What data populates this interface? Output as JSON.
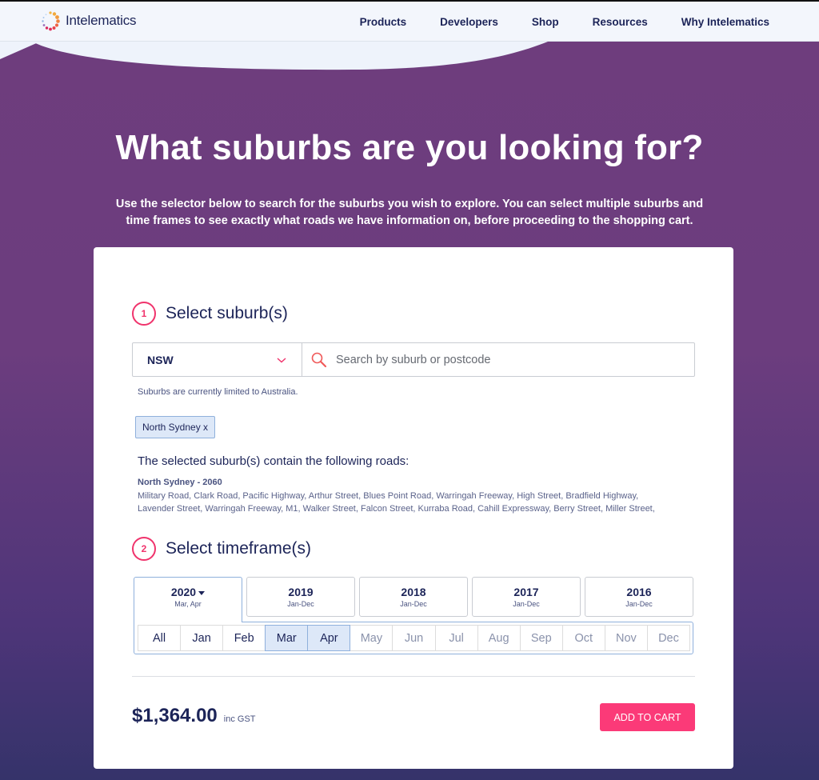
{
  "brand": {
    "name": "Intelematics"
  },
  "nav": {
    "items": [
      "Products",
      "Developers",
      "Shop",
      "Resources",
      "Why Intelematics"
    ]
  },
  "hero": {
    "title": "What suburbs are you looking for?",
    "subtitle": "Use the selector below to search for the suburbs you wish to explore. You can select multiple suburbs and time frames to see exactly what roads we have information on, before proceeding to the shopping cart."
  },
  "step1": {
    "number": "1",
    "title": "Select suburb(s)",
    "state_value": "NSW",
    "search_placeholder": "Search by suburb or postcode",
    "search_value": "",
    "hint": "Suburbs are currently limited to Australia.",
    "selected_chip": "North Sydney x",
    "roads_heading": "The selected suburb(s) contain the following roads:",
    "roads_suburb": "North Sydney - 2060",
    "roads_list": "Military Road, Clark Road, Pacific Highway, Arthur Street, Blues Point Road, Warringah Freeway, High Street, Bradfield Highway, Lavender Street, Warringah Freeway, M1, Walker Street, Falcon Street, Kurraba Road, Cahill Expressway, Berry Street, Miller Street,"
  },
  "step2": {
    "number": "2",
    "title": "Select timeframe(s)",
    "years": [
      {
        "label": "2020",
        "range": "Mar, Apr",
        "active": true
      },
      {
        "label": "2019",
        "range": "Jan-Dec",
        "active": false
      },
      {
        "label": "2018",
        "range": "Jan-Dec",
        "active": false
      },
      {
        "label": "2017",
        "range": "Jan-Dec",
        "active": false
      },
      {
        "label": "2016",
        "range": "Jan-Dec",
        "active": false
      }
    ],
    "months": [
      {
        "label": "All",
        "state": "normal"
      },
      {
        "label": "Jan",
        "state": "normal"
      },
      {
        "label": "Feb",
        "state": "normal"
      },
      {
        "label": "Mar",
        "state": "selected"
      },
      {
        "label": "Apr",
        "state": "selected"
      },
      {
        "label": "May",
        "state": "disabled"
      },
      {
        "label": "Jun",
        "state": "disabled"
      },
      {
        "label": "Jul",
        "state": "disabled"
      },
      {
        "label": "Aug",
        "state": "disabled"
      },
      {
        "label": "Sep",
        "state": "disabled"
      },
      {
        "label": "Oct",
        "state": "disabled"
      },
      {
        "label": "Nov",
        "state": "disabled"
      },
      {
        "label": "Dec",
        "state": "disabled"
      }
    ]
  },
  "footer": {
    "price": "$1,364.00",
    "price_note": "inc GST",
    "add_to_cart": "ADD TO CART"
  },
  "colors": {
    "accent": "#fb3a78",
    "navy": "#1c2458",
    "purple_bg": "#6e3d7d",
    "selected_bg": "#dde8f8"
  }
}
